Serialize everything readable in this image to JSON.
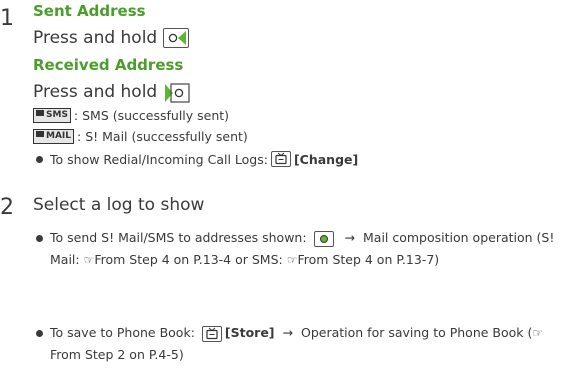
{
  "step1": {
    "number": "1",
    "sent_heading": "Sent Address",
    "sent_instruction": "Press and hold",
    "received_heading": "Received Address",
    "received_instruction": "Press and hold",
    "sms_badge": "SMS",
    "sms_desc": ": SMS (successfully sent)",
    "mail_badge": "MAIL",
    "mail_desc": ": S! Mail (successfully sent)",
    "tip_text": "To show Redial/Incoming Call Logs:",
    "tip_action": "[Change]"
  },
  "step2": {
    "number": "2",
    "title": "Select a log to show",
    "bullet1_a": "To send S! Mail/SMS to addresses shown:",
    "bullet1_arrow": "→",
    "bullet1_b": "Mail composition operation (S! Mail:",
    "bullet1_ref1": "From Step 4 on P.13-4 or SMS:",
    "bullet1_ref2": "From Step 4 on P.13-7)",
    "bullet2_a": "To save to Phone Book:",
    "bullet2_action": "[Store]",
    "bullet2_arrow": "→",
    "bullet2_b": "Operation for saving to Phone Book (",
    "bullet2_ref": "From Step 2 on P.4-5)"
  },
  "icons": {
    "ref_glyph": "☞"
  },
  "colors": {
    "heading_green": "#4a9e2a",
    "body_text": "#3a3a3a",
    "key_green": "#5cb82e"
  }
}
